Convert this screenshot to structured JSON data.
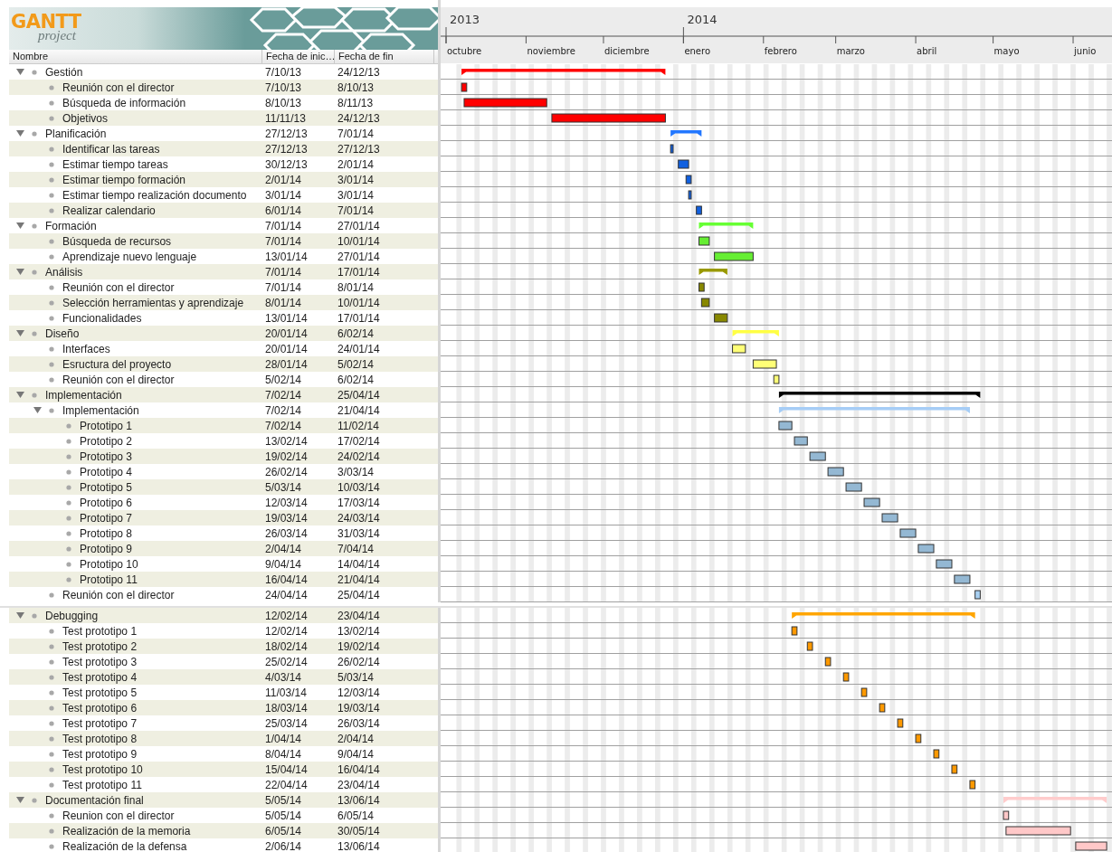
{
  "logo": {
    "brand": "GANTT",
    "product": "project"
  },
  "columns": [
    "Nombre",
    "Fecha de inic…",
    "Fecha de fin"
  ],
  "timeline": {
    "years": [
      {
        "label": "2013",
        "months": [
          "octubre",
          "noviembre",
          "diciembre"
        ]
      },
      {
        "label": "2014",
        "months": [
          "enero",
          "febrero",
          "marzo",
          "abril",
          "mayo",
          "junio"
        ]
      }
    ]
  },
  "blocks": [
    {
      "tasks": [
        {
          "name": "Gestión",
          "start": "7/10/13",
          "end": "24/12/13",
          "color": "#ff0000",
          "expanded": true,
          "children": [
            {
              "name": "Reunión con el director",
              "start": "7/10/13",
              "end": "8/10/13",
              "color": "#ff0000"
            },
            {
              "name": "Búsqueda de información",
              "start": "8/10/13",
              "end": "8/11/13",
              "color": "#ff0000"
            },
            {
              "name": "Objetivos",
              "start": "11/11/13",
              "end": "24/12/13",
              "color": "#ff0000"
            }
          ]
        },
        {
          "name": "Planificación",
          "start": "27/12/13",
          "end": "7/01/14",
          "color": "#2277ff",
          "expanded": true,
          "children": [
            {
              "name": "Identificar las tareas",
              "start": "27/12/13",
              "end": "27/12/13",
              "color": "#1060e0"
            },
            {
              "name": "Estimar tiempo tareas",
              "start": "30/12/13",
              "end": "2/01/14",
              "color": "#1060e0"
            },
            {
              "name": "Estimar tiempo formación",
              "start": "2/01/14",
              "end": "3/01/14",
              "color": "#1060e0"
            },
            {
              "name": "Estimar tiempo realización documento",
              "start": "3/01/14",
              "end": "3/01/14",
              "color": "#1060e0"
            },
            {
              "name": "Realizar calendario",
              "start": "6/01/14",
              "end": "7/01/14",
              "color": "#1060e0"
            }
          ]
        },
        {
          "name": "Formación",
          "start": "7/01/14",
          "end": "27/01/14",
          "color": "#66ff33",
          "expanded": true,
          "children": [
            {
              "name": "Búsqueda de recursos",
              "start": "7/01/14",
              "end": "10/01/14",
              "color": "#66ee33"
            },
            {
              "name": "Aprendizaje nuevo lenguaje",
              "start": "13/01/14",
              "end": "27/01/14",
              "color": "#66ee33"
            }
          ]
        },
        {
          "name": "Análisis",
          "start": "7/01/14",
          "end": "17/01/14",
          "color": "#999900",
          "expanded": true,
          "children": [
            {
              "name": "Reunión con el director",
              "start": "7/01/14",
              "end": "8/01/14",
              "color": "#888800"
            },
            {
              "name": "Selección herramientas y aprendizaje",
              "start": "8/01/14",
              "end": "10/01/14",
              "color": "#888800"
            },
            {
              "name": "Funcionalidades",
              "start": "13/01/14",
              "end": "17/01/14",
              "color": "#888800"
            }
          ]
        },
        {
          "name": "Diseño",
          "start": "20/01/14",
          "end": "6/02/14",
          "color": "#ffff44",
          "expanded": true,
          "children": [
            {
              "name": "Interfaces",
              "start": "20/01/14",
              "end": "24/01/14",
              "color": "#ffff77"
            },
            {
              "name": "Esructura del proyecto",
              "start": "28/01/14",
              "end": "5/02/14",
              "color": "#ffff77"
            },
            {
              "name": "Reunión con el director",
              "start": "5/02/14",
              "end": "6/02/14",
              "color": "#ffff77"
            }
          ]
        },
        {
          "name": "Implementación",
          "start": "7/02/14",
          "end": "25/04/14",
          "color": "#000000",
          "expanded": true,
          "children": [
            {
              "name": "Implementación",
              "start": "7/02/14",
              "end": "21/04/14",
              "color": "#a6cdf6",
              "expanded": true,
              "children": [
                {
                  "name": "Prototipo 1",
                  "start": "7/02/14",
                  "end": "11/02/14",
                  "color": "#94b8d3"
                },
                {
                  "name": "Prototipo 2",
                  "start": "13/02/14",
                  "end": "17/02/14",
                  "color": "#94b8d3"
                },
                {
                  "name": "Prototipo 3",
                  "start": "19/02/14",
                  "end": "24/02/14",
                  "color": "#94b8d3"
                },
                {
                  "name": "Prototipo 4",
                  "start": "26/02/14",
                  "end": "3/03/14",
                  "color": "#94b8d3"
                },
                {
                  "name": "Prototipo 5",
                  "start": "5/03/14",
                  "end": "10/03/14",
                  "color": "#94b8d3"
                },
                {
                  "name": "Prototipo 6",
                  "start": "12/03/14",
                  "end": "17/03/14",
                  "color": "#94b8d3"
                },
                {
                  "name": "Prototipo 7",
                  "start": "19/03/14",
                  "end": "24/03/14",
                  "color": "#94b8d3"
                },
                {
                  "name": "Prototipo 8",
                  "start": "26/03/14",
                  "end": "31/03/14",
                  "color": "#94b8d3"
                },
                {
                  "name": "Prototipo 9",
                  "start": "2/04/14",
                  "end": "7/04/14",
                  "color": "#94b8d3"
                },
                {
                  "name": "Prototipo 10",
                  "start": "9/04/14",
                  "end": "14/04/14",
                  "color": "#94b8d3"
                },
                {
                  "name": "Prototipo 11",
                  "start": "16/04/14",
                  "end": "21/04/14",
                  "color": "#94b8d3"
                }
              ]
            },
            {
              "name": "Reunión con el director",
              "start": "24/04/14",
              "end": "25/04/14",
              "color": "#a8d0f2"
            }
          ]
        }
      ]
    },
    {
      "tasks": [
        {
          "name": "Debugging",
          "start": "12/02/14",
          "end": "23/04/14",
          "color": "#ffa500",
          "expanded": true,
          "children": [
            {
              "name": "Test prototipo 1",
              "start": "12/02/14",
              "end": "13/02/14",
              "color": "#ff9900"
            },
            {
              "name": "Test prototipo 2",
              "start": "18/02/14",
              "end": "19/02/14",
              "color": "#ff9900"
            },
            {
              "name": "Test prototipo 3",
              "start": "25/02/14",
              "end": "26/02/14",
              "color": "#ff9900"
            },
            {
              "name": "Test prototipo 4",
              "start": "4/03/14",
              "end": "5/03/14",
              "color": "#ff9900"
            },
            {
              "name": "Test prototipo 5",
              "start": "11/03/14",
              "end": "12/03/14",
              "color": "#ff9900"
            },
            {
              "name": "Test prototipo 6",
              "start": "18/03/14",
              "end": "19/03/14",
              "color": "#ff9900"
            },
            {
              "name": "Test prototipo 7",
              "start": "25/03/14",
              "end": "26/03/14",
              "color": "#ff9900"
            },
            {
              "name": "Test prototipo 8",
              "start": "1/04/14",
              "end": "2/04/14",
              "color": "#ff9900"
            },
            {
              "name": "Test prototipo 9",
              "start": "8/04/14",
              "end": "9/04/14",
              "color": "#ff9900"
            },
            {
              "name": "Test prototipo 10",
              "start": "15/04/14",
              "end": "16/04/14",
              "color": "#ff9900"
            },
            {
              "name": "Test prototipo 11",
              "start": "22/04/14",
              "end": "23/04/14",
              "color": "#ff9900"
            }
          ]
        },
        {
          "name": "Documentación final",
          "start": "5/05/14",
          "end": "13/06/14",
          "color": "#ffcccc",
          "expanded": true,
          "children": [
            {
              "name": "Reunion con el director",
              "start": "5/05/14",
              "end": "6/05/14",
              "color": "#ffc8c8"
            },
            {
              "name": "Realización de la memoria",
              "start": "6/05/14",
              "end": "30/05/14",
              "color": "#ffc8c8"
            },
            {
              "name": "Realización de la defensa",
              "start": "2/06/14",
              "end": "13/06/14",
              "color": "#ffc8c8"
            }
          ]
        }
      ]
    }
  ]
}
